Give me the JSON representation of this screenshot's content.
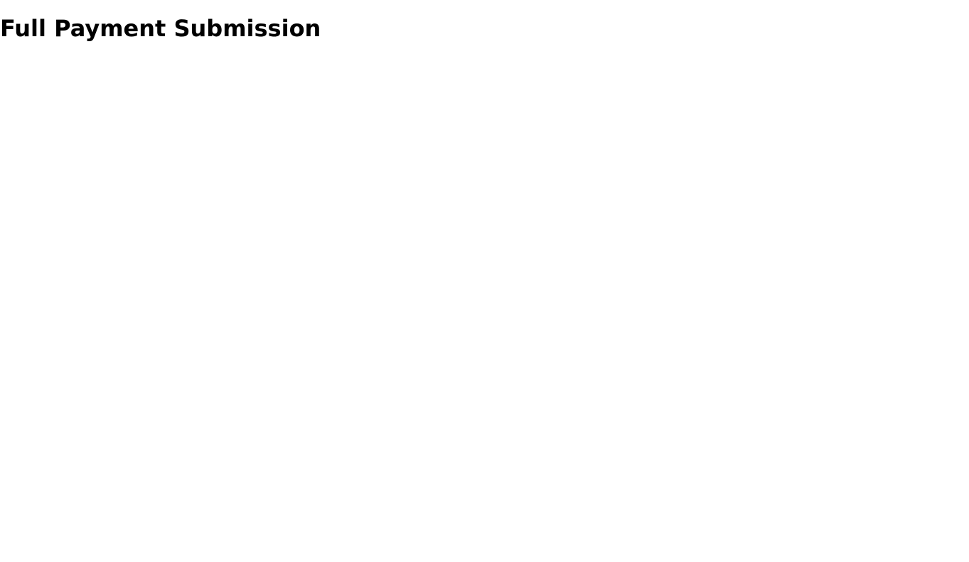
{
  "title": "Full Payment Submission"
}
